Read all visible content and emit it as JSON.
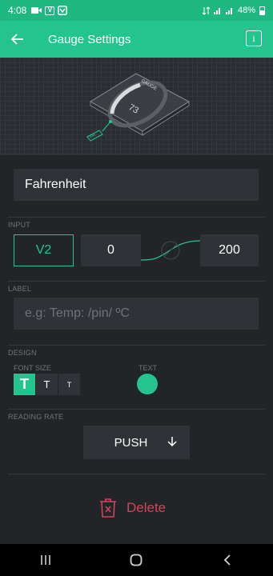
{
  "status_bar": {
    "time": "4:08",
    "battery": "48%",
    "left_icons": [
      "video-camera-icon",
      "v-app-icon",
      "shield-app-icon"
    ],
    "right_icons": [
      "data-saver-icon",
      "signal-icon",
      "signal-icon",
      "battery-icon"
    ]
  },
  "app_bar": {
    "title": "Gauge Settings",
    "info_label": "i",
    "accent": "#23c48e"
  },
  "hero": {
    "gauge_label": "GAUGE",
    "gauge_value": "73",
    "pin_label": "PIN"
  },
  "widget_name": "Fahrenheit",
  "input_section": {
    "label": "INPUT",
    "pin": "V2",
    "min": "0",
    "max": "200"
  },
  "label_section": {
    "label": "LABEL",
    "placeholder": "e.g: Temp: /pin/ ºC"
  },
  "design_section": {
    "label": "DESIGN",
    "font_size_label": "FONT SIZE",
    "font_sizes": [
      "T",
      "T",
      "T"
    ],
    "text_label": "TEXT",
    "text_color": "#23c48e"
  },
  "reading_rate_section": {
    "label": "READING RATE",
    "value": "PUSH"
  },
  "delete_label": "Delete",
  "delete_color": "#d3435c"
}
